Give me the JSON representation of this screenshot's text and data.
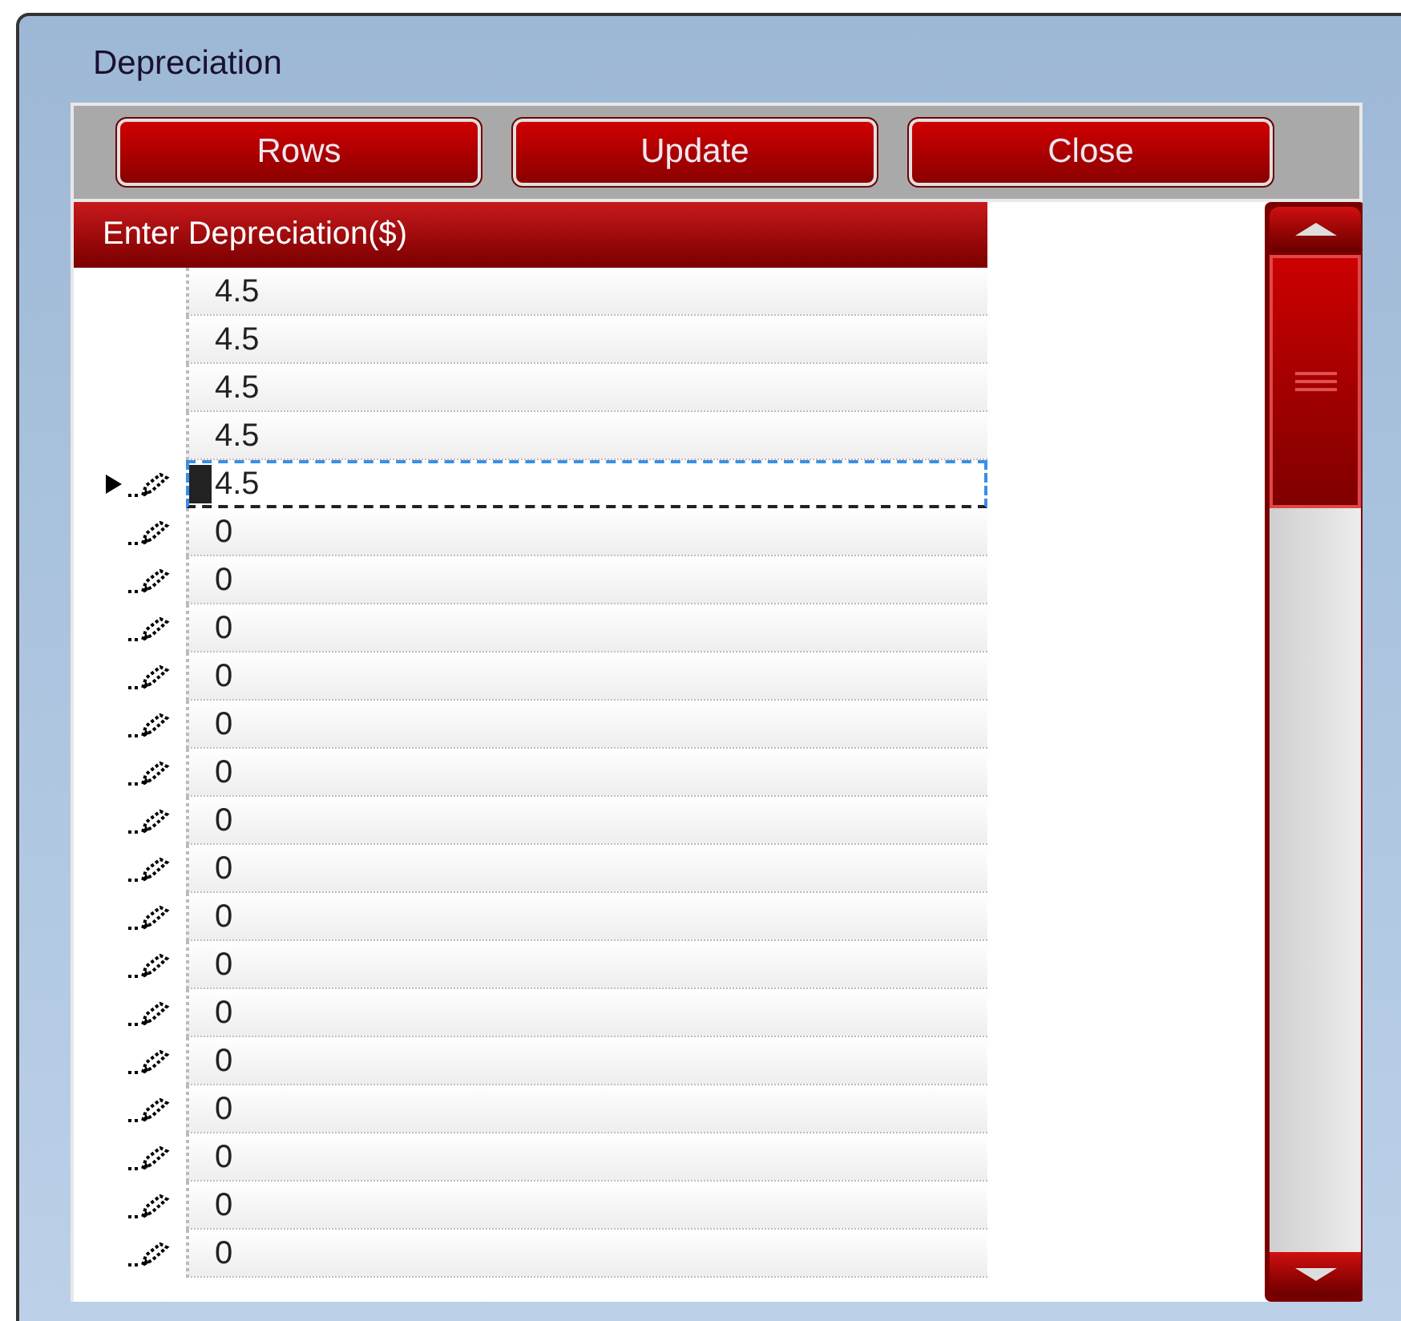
{
  "window": {
    "title": "Depreciation"
  },
  "toolbar": {
    "buttons": [
      "Rows",
      "Update",
      "Close"
    ]
  },
  "grid": {
    "column": "Enter Depreciation($)",
    "rows": [
      {
        "value": "4.5",
        "selected": false,
        "edited": false
      },
      {
        "value": "4.5",
        "selected": false,
        "edited": false
      },
      {
        "value": "4.5",
        "selected": false,
        "edited": false
      },
      {
        "value": "4.5",
        "selected": false,
        "edited": false
      },
      {
        "value": "4.5",
        "selected": true,
        "edited": true
      },
      {
        "value": "0",
        "selected": false,
        "edited": true
      },
      {
        "value": "0",
        "selected": false,
        "edited": true
      },
      {
        "value": "0",
        "selected": false,
        "edited": true
      },
      {
        "value": "0",
        "selected": false,
        "edited": true
      },
      {
        "value": "0",
        "selected": false,
        "edited": true
      },
      {
        "value": "0",
        "selected": false,
        "edited": true
      },
      {
        "value": "0",
        "selected": false,
        "edited": true
      },
      {
        "value": "0",
        "selected": false,
        "edited": true
      },
      {
        "value": "0",
        "selected": false,
        "edited": true
      },
      {
        "value": "0",
        "selected": false,
        "edited": true
      },
      {
        "value": "0",
        "selected": false,
        "edited": true
      },
      {
        "value": "0",
        "selected": false,
        "edited": true
      },
      {
        "value": "0",
        "selected": false,
        "edited": true
      },
      {
        "value": "0",
        "selected": false,
        "edited": true
      },
      {
        "value": "0",
        "selected": false,
        "edited": true
      },
      {
        "value": "0",
        "selected": false,
        "edited": true
      }
    ]
  }
}
